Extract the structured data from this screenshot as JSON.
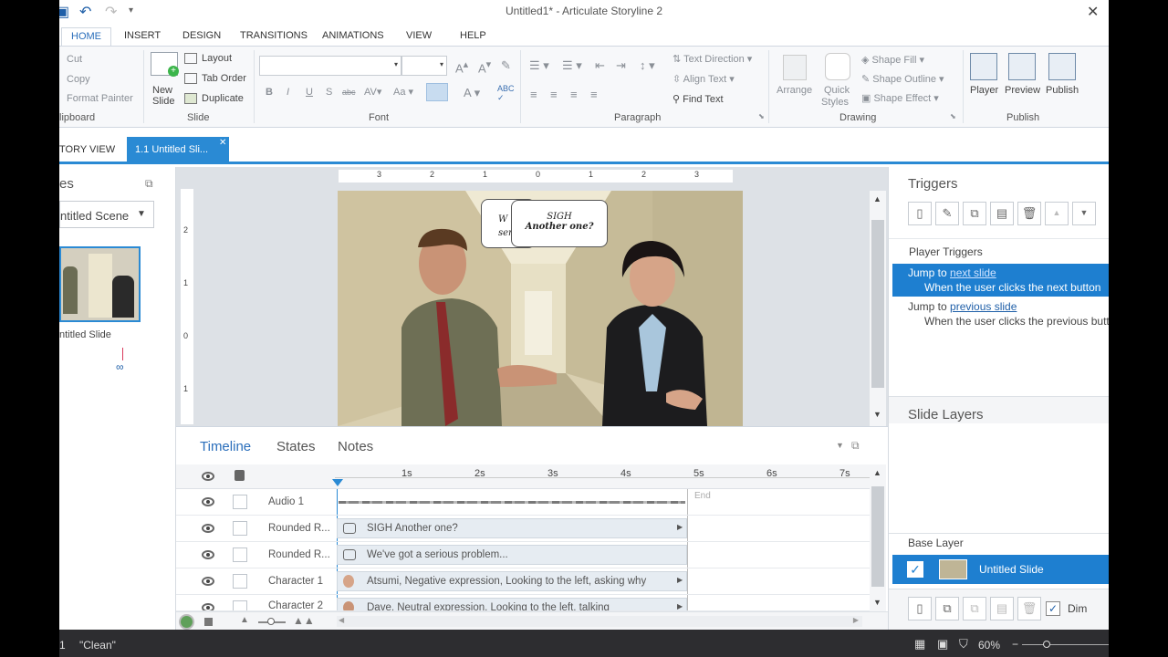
{
  "window": {
    "title": "Untitled1* -  Articulate Storyline 2"
  },
  "ribbon_tabs": [
    "HOME",
    "INSERT",
    "DESIGN",
    "TRANSITIONS",
    "ANIMATIONS",
    "VIEW",
    "HELP"
  ],
  "clipboard": {
    "cut": "Cut",
    "copy": "Copy",
    "format_painter": "Format Painter",
    "group": "lipboard"
  },
  "slide_group": {
    "new_slide_1": "New",
    "new_slide_2": "Slide",
    "layout": "Layout",
    "tab_order": "Tab Order",
    "duplicate": "Duplicate",
    "group": "Slide"
  },
  "font_group": {
    "group": "Font"
  },
  "paragraph_group": {
    "text_direction": "Text Direction",
    "align_text": "Align Text",
    "find_text": "Find Text",
    "group": "Paragraph"
  },
  "drawing_group": {
    "arrange": "Arrange",
    "quick_styles_1": "Quick",
    "quick_styles_2": "Styles",
    "shape_fill": "Shape Fill",
    "shape_outline": "Shape Outline",
    "shape_effect": "Shape Effect",
    "group": "Drawing"
  },
  "publish_group": {
    "player": "Player",
    "preview": "Preview",
    "publish": "Publish",
    "group": "Publish"
  },
  "view_tabs": {
    "story_view": "TORY VIEW",
    "slide_tab": "1.1 Untitled Sli..."
  },
  "left_panel": {
    "header": "es",
    "scene_select": "ntitled Scene",
    "slide_label": "ntitled Slide"
  },
  "stage": {
    "ruler_h": [
      "3",
      "2",
      "1",
      "0",
      "1",
      "2",
      "3"
    ],
    "ruler_v": [
      "2",
      "1",
      "0",
      "1"
    ],
    "bubble_back": "W\nserio",
    "bubble_front_line1": "SIGH",
    "bubble_front_line2": "Another one?"
  },
  "timeline": {
    "tabs": [
      "Timeline",
      "States",
      "Notes"
    ],
    "ticks": [
      "1s",
      "2s",
      "3s",
      "4s",
      "5s",
      "6s",
      "7s"
    ],
    "end_label": "End",
    "rows": [
      {
        "name": "Audio 1",
        "bar": ""
      },
      {
        "name": "Rounded R...",
        "bar": "SIGH Another one?"
      },
      {
        "name": "Rounded R...",
        "bar": "We've got a serious problem..."
      },
      {
        "name": "Character 1",
        "bar": "Atsumi, Negative expression, Looking to the left,  asking why"
      },
      {
        "name": "Character 2",
        "bar": "Dave, Neutral expression, Looking to the left,  talking"
      }
    ]
  },
  "triggers": {
    "header": "Triggers",
    "player_triggers": "Player Triggers",
    "items": [
      {
        "action": "Jump to ",
        "target": "next slide",
        "condition": "When the user clicks the next button"
      },
      {
        "action": "Jump to ",
        "target": "previous slide",
        "condition": "When the user clicks the previous butt"
      }
    ]
  },
  "layers": {
    "header": "Slide Layers",
    "base_layer": "Base Layer",
    "slide": "Untitled Slide",
    "dim": "Dim"
  },
  "status": {
    "left": "1",
    "theme": "\"Clean\"",
    "zoom": "60%"
  },
  "colors": {
    "accent": "#2a8ad4",
    "selection": "#1e7fd0",
    "status_bg": "#2d2d30"
  }
}
